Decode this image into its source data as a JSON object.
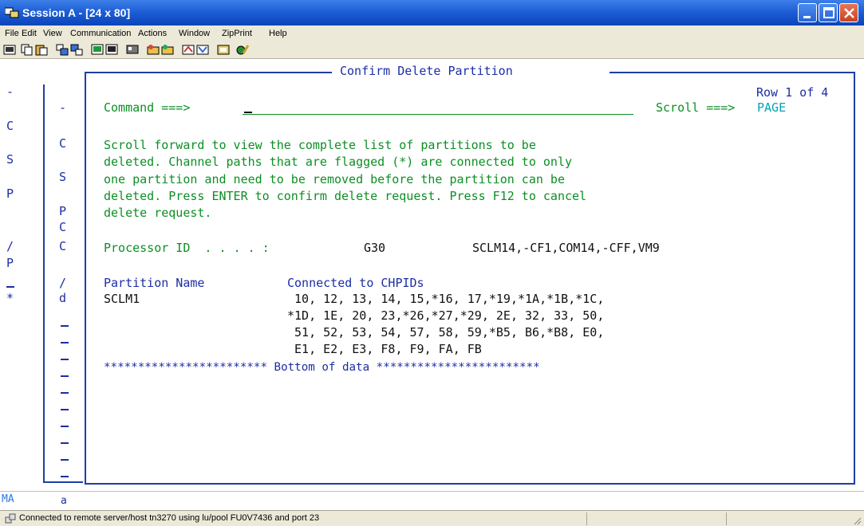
{
  "window": {
    "title": "Session A - [24 x 80]",
    "buttons": {
      "minimize": "minimize",
      "maximize": "maximize",
      "close": "close"
    }
  },
  "menu": [
    "File",
    "Edit",
    "View",
    "Communication",
    "Actions",
    "Window",
    "ZipPrint",
    "Help"
  ],
  "toolbar": [
    "print-screen-icon",
    "copy-icon",
    "paste-icon",
    "send-file-icon",
    "receive-file-icon",
    "display-icon",
    "keypad-icon",
    "color-icon",
    "record-macro-icon",
    "play-macro-icon",
    "stop-macro-icon",
    "customize-icon",
    "help-icon",
    "about-icon"
  ],
  "panel": {
    "title": "Confirm Delete Partition",
    "row_info": "Row 1 of 4",
    "command_label": "Command ===>",
    "command_value": "",
    "scroll_label": "Scroll ===>",
    "scroll_value": "PAGE",
    "instructions": [
      "Scroll forward to view the complete list of partitions to be",
      "deleted. Channel paths that are flagged (*) are connected to only",
      "one partition and need to be removed before the partition can be",
      "deleted. Press ENTER to confirm delete request. Press F12 to cancel",
      "delete request."
    ],
    "processor_label": "Processor ID  . . . . :",
    "processor_value": "G30",
    "processor_desc": "SCLM14,-CF1,COM14,-CFF,VM9",
    "col_partition": "Partition Name",
    "col_chpids": "Connected to CHPIDs",
    "partition_name": "SCLM1",
    "chpid_lines": [
      " 10, 12, 13, 14, 15,*16, 17,*19,*1A,*1B,*1C,",
      "*1D, 1E, 20, 23,*26,*27,*29, 2E, 32, 33, 50,",
      " 51, 52, 53, 54, 57, 58, 59,*B5, B6,*B8, E0,",
      " E1, E2, E3, F8, F9, FA, FB"
    ],
    "bottom_line": "************************ Bottom of data ************************"
  },
  "left_col1": [
    "-",
    "C",
    "S",
    "P",
    "/",
    "P",
    "*"
  ],
  "left_col2": [
    "-",
    "C",
    "S",
    "P",
    "C",
    "C",
    "/",
    "d"
  ],
  "oia": {
    "left": "MA",
    "indicator": "a"
  },
  "status": {
    "message": "Connected to remote server/host tn3270 using lu/pool FU0V7436 and port 23"
  },
  "colors": {
    "frame": "#1f3fa0",
    "text_blue": "#1c2ea4",
    "text_green": "#0c8f24",
    "text_cyan": "#05a3b4",
    "titlebar": "#1e5fd6"
  }
}
